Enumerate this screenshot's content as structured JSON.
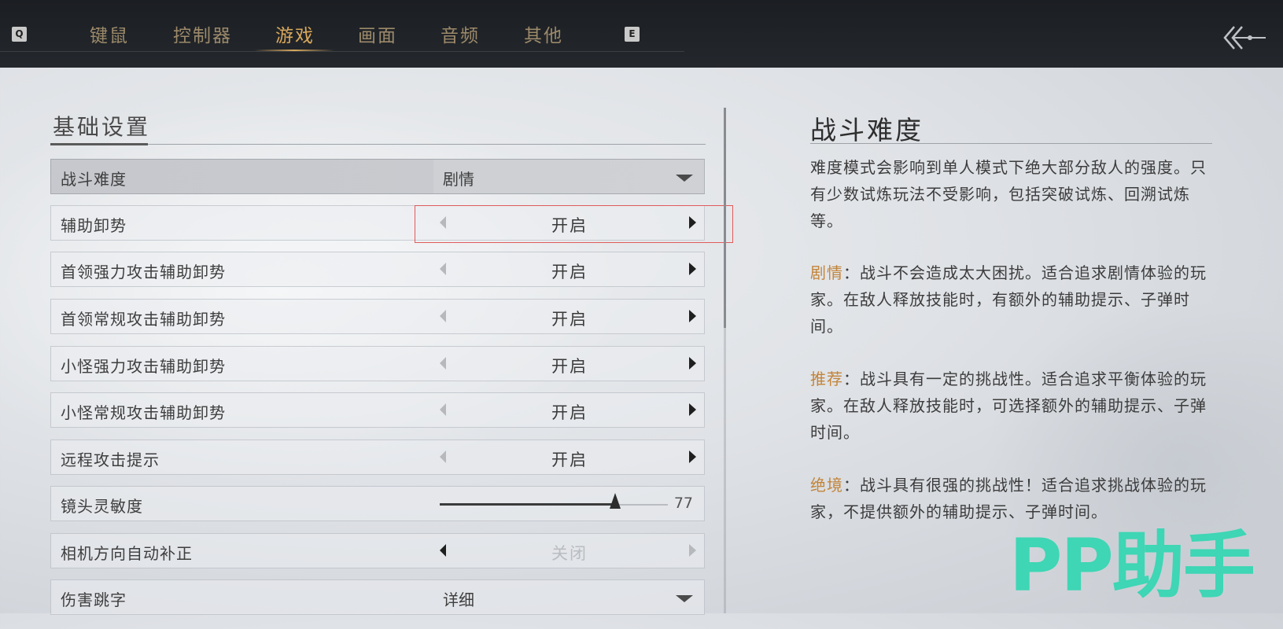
{
  "topbar": {
    "left_key": "Q",
    "right_key": "E",
    "tabs": [
      {
        "label": "键鼠",
        "active": false
      },
      {
        "label": "控制器",
        "active": false
      },
      {
        "label": "游戏",
        "active": true
      },
      {
        "label": "画面",
        "active": false
      },
      {
        "label": "音频",
        "active": false
      },
      {
        "label": "其他",
        "active": false
      }
    ],
    "accent_color": "#d9a85c"
  },
  "section": {
    "title": "基础设置"
  },
  "settings": [
    {
      "label": "战斗难度",
      "type": "dropdown",
      "value": "剧情"
    },
    {
      "label": "辅助卸势",
      "type": "toggle",
      "value": "开启"
    },
    {
      "label": "首领强力攻击辅助卸势",
      "type": "toggle",
      "value": "开启"
    },
    {
      "label": "首领常规攻击辅助卸势",
      "type": "toggle",
      "value": "开启"
    },
    {
      "label": "小怪强力攻击辅助卸势",
      "type": "toggle",
      "value": "开启"
    },
    {
      "label": "小怪常规攻击辅助卸势",
      "type": "toggle",
      "value": "开启"
    },
    {
      "label": "远程攻击提示",
      "type": "toggle",
      "value": "开启"
    },
    {
      "label": "镜头灵敏度",
      "type": "slider",
      "value": "77",
      "level": 0.77
    },
    {
      "label": "相机方向自动补正",
      "type": "toggle",
      "value": "关闭"
    },
    {
      "label": "伤害跳字",
      "type": "dropdown",
      "value": "详细"
    }
  ],
  "description": {
    "title": "战斗难度",
    "intro": "难度模式会影响到单人模式下绝大部分敌人的强度。只有少数试炼玩法不受影响，包括突破试炼、回溯试炼等。",
    "modes": [
      {
        "name": "剧情",
        "text": "：战斗不会造成太大困扰。适合追求剧情体验的玩家。在敌人释放技能时，有额外的辅助提示、子弹时间。"
      },
      {
        "name": "推荐",
        "text": "：战斗具有一定的挑战性。适合追求平衡体验的玩家。在敌人释放技能时，可选择额外的辅助提示、子弹时间。"
      },
      {
        "name": "绝境",
        "text": "：战斗具有很强的挑战性！适合追求挑战体验的玩家，不提供额外的辅助提示、子弹时间。"
      }
    ],
    "keyword_color": "#c2843a"
  },
  "watermark": "PP助手"
}
